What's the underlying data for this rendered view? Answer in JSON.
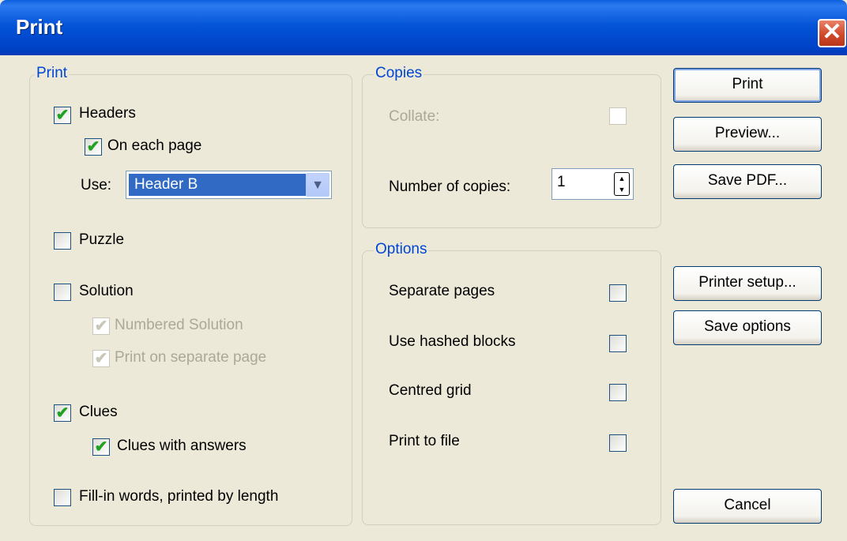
{
  "window": {
    "title": "Print",
    "close_glyph": "✕"
  },
  "print_group": {
    "legend": "Print",
    "headers": {
      "label": "Headers",
      "checked": true
    },
    "on_each_page": {
      "label": "On each page",
      "checked": true
    },
    "use_label": "Use:",
    "use_value": "Header B",
    "puzzle": {
      "label": "Puzzle",
      "checked": false
    },
    "solution": {
      "label": "Solution",
      "checked": false
    },
    "numbered_solution": {
      "label": "Numbered Solution",
      "checked": true,
      "disabled": true
    },
    "print_separate": {
      "label": "Print on separate page",
      "checked": true,
      "disabled": true
    },
    "clues": {
      "label": "Clues",
      "checked": true
    },
    "clues_answers": {
      "label": "Clues with answers",
      "checked": true
    },
    "fill_in": {
      "label": "Fill-in words, printed by length",
      "checked": false
    }
  },
  "copies_group": {
    "legend": "Copies",
    "collate_label": "Collate:",
    "number_label": "Number of copies:",
    "number_value": "1"
  },
  "options_group": {
    "legend": "Options",
    "separate_pages": "Separate pages",
    "hashed_blocks": "Use hashed blocks",
    "centred_grid": "Centred grid",
    "print_to_file": "Print to file"
  },
  "buttons": {
    "print": "Print",
    "preview": "Preview...",
    "save_pdf": "Save PDF...",
    "printer_setup": "Printer setup...",
    "save_options": "Save options",
    "cancel": "Cancel"
  },
  "colors": {
    "title_bar": "#0454D8",
    "legend": "#0046D5",
    "check": "#21A121",
    "selection": "#316AC5"
  },
  "icons": {
    "check": "✔",
    "dropdown": "chevron-down-icon",
    "close": "close-icon"
  }
}
